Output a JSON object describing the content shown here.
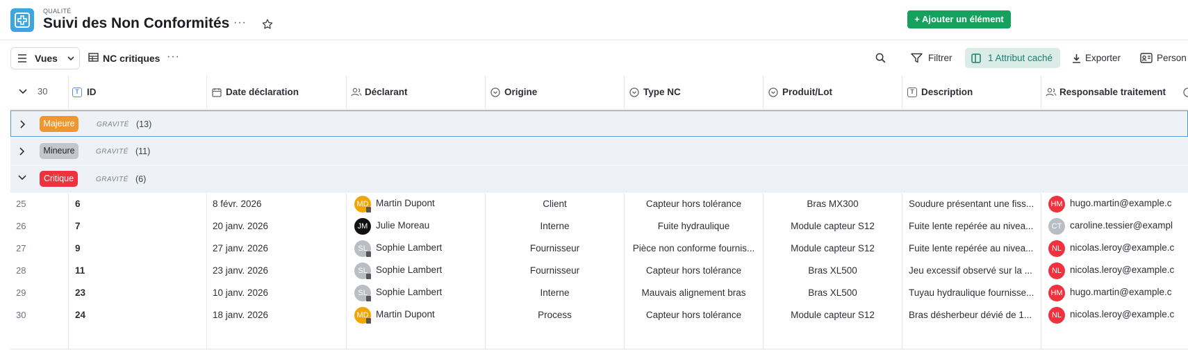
{
  "header": {
    "breadcrumb": "QUALITÉ",
    "title": "Suivi des Non Conformités",
    "more": "···",
    "add_button": "+ Ajouter un élément"
  },
  "toolbar": {
    "views_label": "Vues",
    "view_name": "NC critiques",
    "more": "···",
    "filter": "Filtrer",
    "hidden_attr": "1 Attribut caché",
    "export": "Exporter",
    "person": "Person"
  },
  "table": {
    "row_count": "30",
    "columns": [
      "ID",
      "Date déclaration",
      "Déclarant",
      "Origine",
      "Type NC",
      "Produit/Lot",
      "Description",
      "Responsable traitement"
    ],
    "groups": [
      {
        "label": "Majeure",
        "field": "GRAVITÉ",
        "count": "(13)",
        "color": "#f0962e"
      },
      {
        "label": "Mineure",
        "field": "GRAVITÉ",
        "count": "(11)",
        "color": "#c3c7cc"
      },
      {
        "label": "Critique",
        "field": "GRAVITÉ",
        "count": "(6)",
        "color": "#f0323e"
      }
    ],
    "rows": [
      {
        "n": "25",
        "id": "6",
        "date": "8 févr. 2026",
        "declarant": "Martin Dupont",
        "initials": "MD",
        "origine": "Client",
        "type": "Capteur hors tolérance",
        "produit": "Bras MX300",
        "desc": "Soudure présentant une fiss...",
        "resp_initials": "HM",
        "resp": "hugo.martin@example.c"
      },
      {
        "n": "26",
        "id": "7",
        "date": "20 janv. 2026",
        "declarant": "Julie Moreau",
        "initials": "JM",
        "origine": "Interne",
        "type": "Fuite hydraulique",
        "produit": "Module capteur S12",
        "desc": "Fuite lente repérée au nivea...",
        "resp_initials": "CT",
        "resp": "caroline.tessier@exampl"
      },
      {
        "n": "27",
        "id": "9",
        "date": "27 janv. 2026",
        "declarant": "Sophie Lambert",
        "initials": "SL",
        "origine": "Fournisseur",
        "type": "Pièce non conforme fournis...",
        "produit": "Module capteur S12",
        "desc": "Fuite lente repérée au nivea...",
        "resp_initials": "NL",
        "resp": "nicolas.leroy@example.c"
      },
      {
        "n": "28",
        "id": "11",
        "date": "23 janv. 2026",
        "declarant": "Sophie Lambert",
        "initials": "SL",
        "origine": "Fournisseur",
        "type": "Capteur hors tolérance",
        "produit": "Bras XL500",
        "desc": "Jeu excessif observé sur la ...",
        "resp_initials": "NL",
        "resp": "nicolas.leroy@example.c"
      },
      {
        "n": "29",
        "id": "23",
        "date": "10 janv. 2026",
        "declarant": "Sophie Lambert",
        "initials": "SL",
        "origine": "Interne",
        "type": "Mauvais alignement bras",
        "produit": "Bras XL500",
        "desc": "Tuyau hydraulique fournisse...",
        "resp_initials": "HM",
        "resp": "hugo.martin@example.c"
      },
      {
        "n": "30",
        "id": "24",
        "date": "18 janv. 2026",
        "declarant": "Martin Dupont",
        "initials": "MD",
        "origine": "Process",
        "type": "Capteur hors tolérance",
        "produit": "Module capteur S12",
        "desc": "Bras désherbeur dévié de 1...",
        "resp_initials": "NL",
        "resp": "nicolas.leroy@example.c"
      }
    ]
  },
  "colors": {
    "accent_green": "#16a05e",
    "app_icon": "#3ca6e0",
    "avatar_md": "#f0a500",
    "avatar_jm": "#111111",
    "avatar_sl": "#b9bec5",
    "avatar_hm": "#f0323e",
    "avatar_ct": "#b9bec5",
    "avatar_nl": "#f0323e"
  }
}
